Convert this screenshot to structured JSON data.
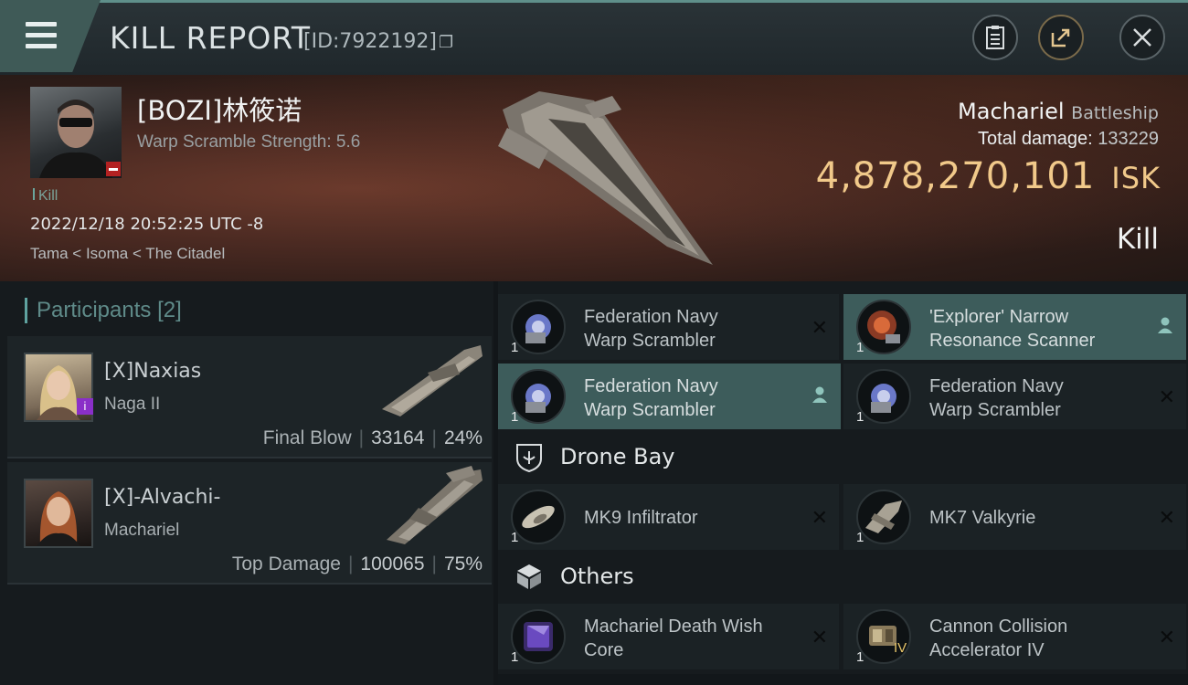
{
  "header": {
    "title": "KILL REPORT",
    "report_id": "[ID:7922192]"
  },
  "victim": {
    "name": "[BOZI]林筱诺",
    "scramble": "Warp Scramble Strength: 5.6",
    "tag": "Kill",
    "datetime": "2022/12/18 20:52:25 UTC -8",
    "location": "Tama < Isoma < The Citadel",
    "ship_name": "Machariel",
    "ship_class": "Battleship",
    "total_damage_label": "Total damage:",
    "total_damage": "133229",
    "isk_value": "4,878,270,101",
    "isk_unit": "ISK",
    "result": "Kill"
  },
  "participants": {
    "title": "Participants",
    "count": "[2]",
    "rows": [
      {
        "name": "[X]Naxias",
        "ship": "Naga II",
        "label": "Final Blow",
        "damage": "33164",
        "percent": "24%"
      },
      {
        "name": "[X]-Alvachi-",
        "ship": "Machariel",
        "label": "Top Damage",
        "damage": "100065",
        "percent": "75%"
      }
    ]
  },
  "modules": {
    "row1": [
      {
        "name1": "Federation Navy",
        "name2": "Warp Scrambler",
        "qty": "1"
      },
      {
        "name1": "'Explorer' Narrow",
        "name2": "Resonance Scanner",
        "qty": "1"
      }
    ],
    "row2": [
      {
        "name1": "Federation Navy",
        "name2": "Warp Scrambler",
        "qty": "1"
      },
      {
        "name1": "Federation Navy",
        "name2": "Warp Scrambler",
        "qty": "1"
      }
    ],
    "drone_bay_label": "Drone Bay",
    "drones": [
      {
        "name": "MK9 Infiltrator",
        "qty": "1"
      },
      {
        "name": "MK7 Valkyrie",
        "qty": "1"
      }
    ],
    "others_label": "Others",
    "others": [
      {
        "name1": "Machariel Death Wish",
        "name2": "Core",
        "qty": "1"
      },
      {
        "name1": "Cannon Collision",
        "name2": "Accelerator IV",
        "qty": "1",
        "badge": "IV"
      }
    ]
  },
  "colors": {
    "accent_teal": "#5fa3a0",
    "isk_gold": "#f1c98a",
    "highlight_row": "#3d5c5b"
  }
}
